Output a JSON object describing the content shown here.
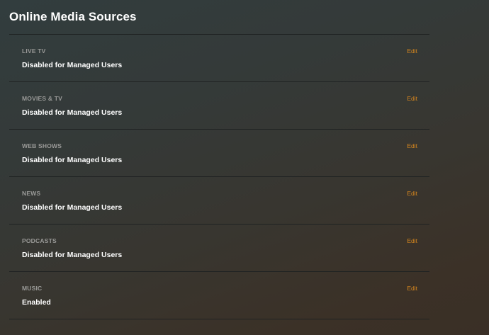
{
  "page": {
    "title": "Online Media Sources"
  },
  "sources": [
    {
      "title": "LIVE TV",
      "status": "Disabled for Managed Users",
      "edit_label": "Edit"
    },
    {
      "title": "MOVIES & TV",
      "status": "Disabled for Managed Users",
      "edit_label": "Edit"
    },
    {
      "title": "WEB SHOWS",
      "status": "Disabled for Managed Users",
      "edit_label": "Edit"
    },
    {
      "title": "NEWS",
      "status": "Disabled for Managed Users",
      "edit_label": "Edit"
    },
    {
      "title": "PODCASTS",
      "status": "Disabled for Managed Users",
      "edit_label": "Edit"
    },
    {
      "title": "MUSIC",
      "status": "Enabled",
      "edit_label": "Edit"
    }
  ],
  "colors": {
    "accent": "#d6861e",
    "section_label": "#9a9a98",
    "text": "#ffffff"
  }
}
